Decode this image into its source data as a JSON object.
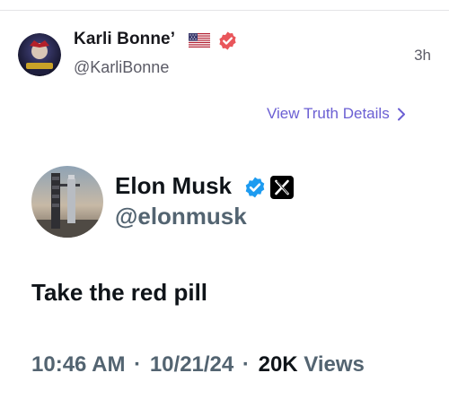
{
  "post": {
    "author_name": "Karli Bonne’",
    "author_handle": "@KarliBonne",
    "time_ago": "3h",
    "view_details_label": "View Truth Details"
  },
  "quote": {
    "name": "Elon Musk",
    "handle": "@elonmusk",
    "text": "Take the red pill",
    "time": "10:46 AM",
    "date": "10/21/24",
    "views_count": "20K",
    "views_label": "Views",
    "separator": "·"
  },
  "icons": {
    "author_badge": "verified-badge-icon",
    "flag": "us-flag-icon",
    "quote_badge": "verified-badge-icon",
    "platform": "x-logo-icon",
    "chevron": "chevron-right-icon"
  },
  "colors": {
    "accent_purple": "#6b5fd3",
    "verified_red": "#e9565b",
    "verified_blue": "#1d9bf0",
    "muted_text": "#536471"
  }
}
